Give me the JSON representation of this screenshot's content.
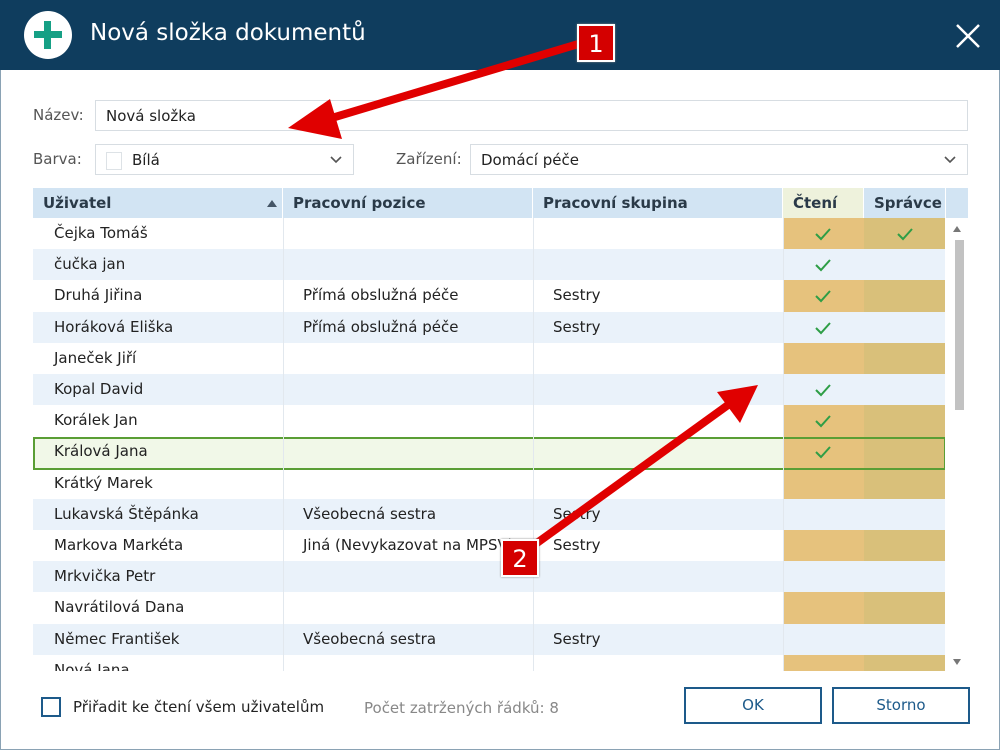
{
  "window": {
    "title": "Nová složka dokumentů"
  },
  "form": {
    "name_label": "Název:",
    "name_value": "Nová složka",
    "color_label": "Barva:",
    "color_value": "Bílá",
    "device_label": "Zařízení:",
    "device_value": "Domácí péče"
  },
  "table": {
    "headers": [
      "Uživatel",
      "Pracovní pozice",
      "Pracovní skupina",
      "Čtení",
      "Správce"
    ],
    "rows": [
      {
        "user": "Čejka Tomáš",
        "position": "",
        "group": "",
        "read": true,
        "admin": true
      },
      {
        "user": "čučka jan",
        "position": "",
        "group": "",
        "read": true,
        "admin": false
      },
      {
        "user": "Druhá Jiřina",
        "position": "Přímá obslužná péče",
        "group": "Sestry",
        "read": true,
        "admin": false
      },
      {
        "user": "Horáková Eliška",
        "position": "Přímá obslužná péče",
        "group": "Sestry",
        "read": true,
        "admin": false
      },
      {
        "user": "Janeček Jiří",
        "position": "",
        "group": "",
        "read": false,
        "admin": false
      },
      {
        "user": "Kopal David",
        "position": "",
        "group": "",
        "read": true,
        "admin": false
      },
      {
        "user": "Korálek Jan",
        "position": "",
        "group": "",
        "read": true,
        "admin": false
      },
      {
        "user": "Králová Jana",
        "position": "",
        "group": "",
        "read": true,
        "admin": false
      },
      {
        "user": "Krátký Marek",
        "position": "",
        "group": "",
        "read": false,
        "admin": false
      },
      {
        "user": "Lukavská Štěpánka",
        "position": "Všeobecná sestra",
        "group": "Sestry",
        "read": false,
        "admin": false
      },
      {
        "user": "Markova Markéta",
        "position": "Jiná (Nevykazovat na MPSV)",
        "group": "Sestry",
        "read": false,
        "admin": false
      },
      {
        "user": "Mrkvička Petr",
        "position": "",
        "group": "",
        "read": false,
        "admin": false
      },
      {
        "user": "Navrátilová Dana",
        "position": "",
        "group": "",
        "read": false,
        "admin": false
      },
      {
        "user": "Němec František",
        "position": "Všeobecná sestra",
        "group": "Sestry",
        "read": false,
        "admin": false
      },
      {
        "user": "Nová Jana",
        "position": "",
        "group": "",
        "read": false,
        "admin": false
      }
    ],
    "selected_row": "Králová Jana"
  },
  "footer": {
    "assign_all_label": "Přiřadit ke čtení všem uživatelům",
    "assign_all_checked": false,
    "checked_count": "Počet zatržených řádků: 8",
    "ok_label": "OK",
    "cancel_label": "Storno"
  },
  "callouts": {
    "one": "1",
    "two": "2"
  },
  "colors": {
    "titlebar": "#0f3d5e",
    "accent": "#16a085",
    "read_column": "#e6c27d",
    "admin_column": "#d9c07a",
    "check": "#2e9e46",
    "selection_border": "#5a9e35",
    "callout": "#e00000"
  },
  "icons": {
    "title": "plus-circle-icon",
    "close": "close-icon",
    "sort": "sort-ascending-icon",
    "dropdown": "chevron-down-icon",
    "check": "checkmark-icon"
  }
}
